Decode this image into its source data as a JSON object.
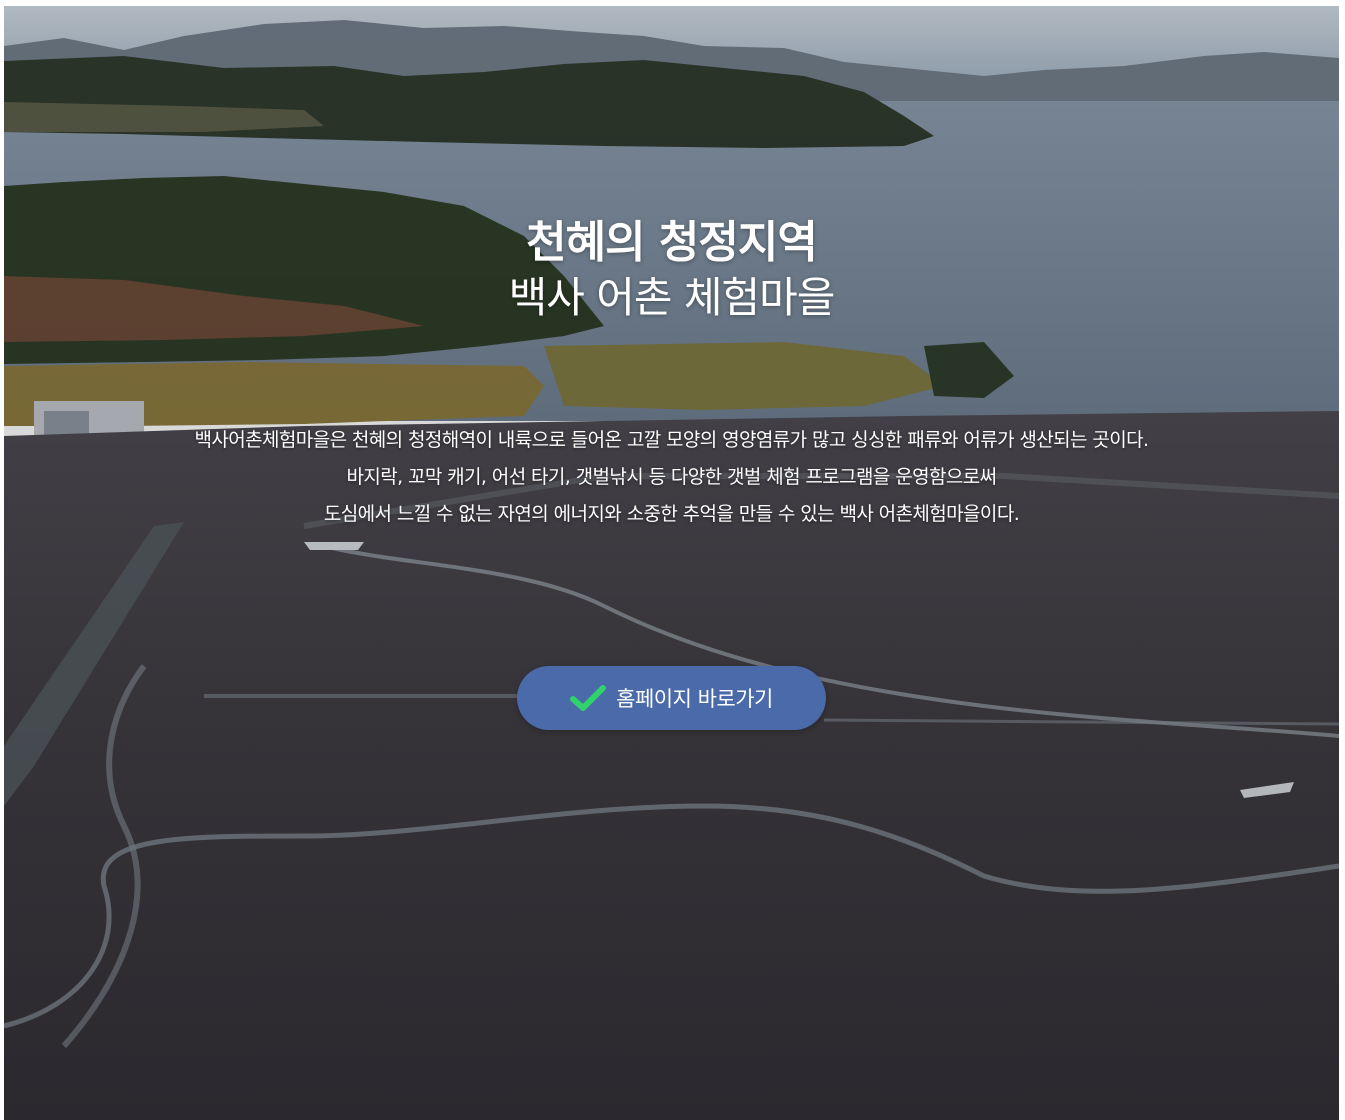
{
  "hero": {
    "title_line1": "천혜의 청정지역",
    "title_line2": "백사 어촌 체험마을",
    "description_lines": [
      "백사어촌체험마을은 천혜의 청정해역이 내륙으로 들어온 고깔 모양의 영양염류가 많고 싱싱한 패류와 어류가 생산되는 곳이다.",
      "바지락, 꼬막 캐기, 어선 타기, 갯벌낚시 등 다양한 갯벌 체험 프로그램을 운영함으로써",
      "도심에서 느낄 수 없는 자연의 에너지와 소중한 추억을 만들 수 있는 백사 어촌체험마을이다."
    ],
    "cta": {
      "label": "홈페이지 바로가기",
      "icon": "check-icon",
      "icon_color": "#2fd26b",
      "background": "#4a6aaa"
    }
  }
}
